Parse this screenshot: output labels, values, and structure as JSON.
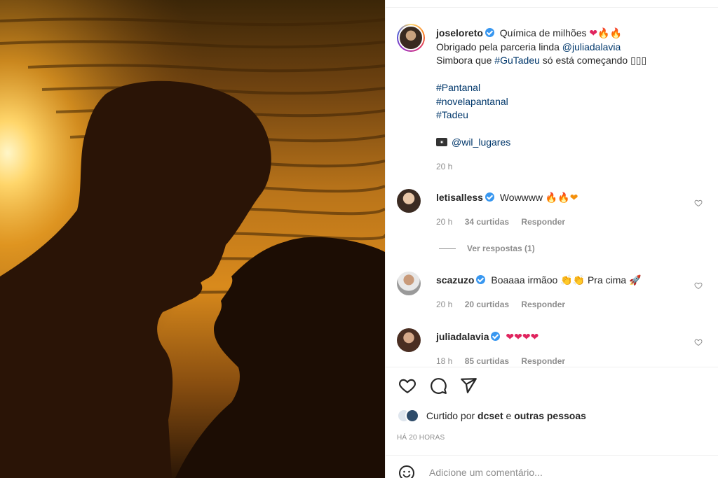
{
  "post": {
    "author": "joseloreto",
    "caption_lines": [
      {
        "text": "Química de milhões ",
        "emoji": "❤🔥🔥"
      },
      {
        "pre": "Obrigado pela parceria linda ",
        "link": "@juliadalavia"
      },
      {
        "pre": "Simbora que ",
        "link": "#GuTadeu",
        "post": " só está começando ▯▯▯"
      }
    ],
    "hashtags": [
      "#Pantanal",
      "#novelapantanal",
      "#Tadeu"
    ],
    "photo_credit": "@wil_lugares",
    "time": "20 h"
  },
  "comments": [
    {
      "user": "letisalless",
      "text": "Wowwww ",
      "emoji": "🔥🔥❤",
      "time": "20 h",
      "likes": "34 curtidas",
      "reply": "Responder",
      "view_replies": "Ver respostas (1)"
    },
    {
      "user": "scazuzo",
      "text": "Boaaaa irmãoo 👏👏 Pra cima 🚀",
      "time": "20 h",
      "likes": "20 curtidas",
      "reply": "Responder"
    },
    {
      "user": "juliadalavia",
      "text": "",
      "emoji": "❤❤❤❤",
      "time": "18 h",
      "likes": "85 curtidas",
      "reply": "Responder"
    }
  ],
  "liked_by": {
    "prefix": "Curtido por ",
    "user": "dcset",
    "mid": " e ",
    "others": "outras pessoas"
  },
  "timestamp": "HÁ 20 HORAS",
  "add_comment": {
    "placeholder": "Adicione um comentário..."
  },
  "icons": [
    "heart-icon",
    "comment-icon",
    "share-icon",
    "camera-icon",
    "emoji-icon",
    "verified-icon"
  ]
}
